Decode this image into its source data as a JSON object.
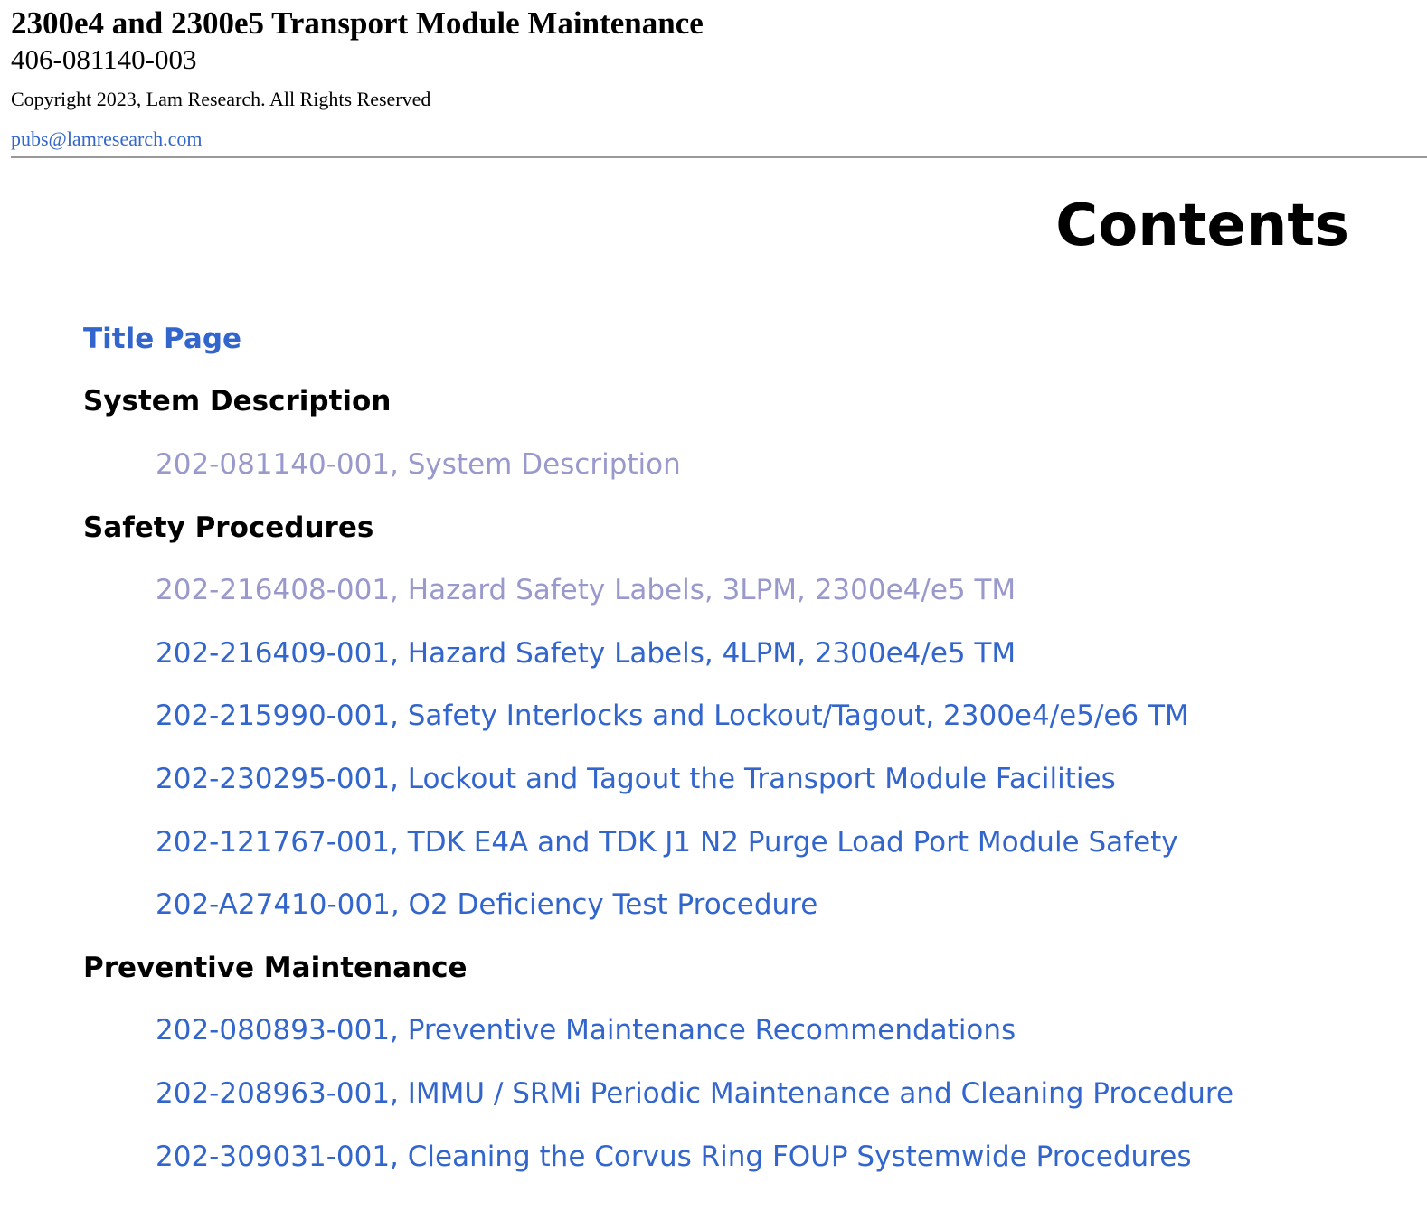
{
  "header": {
    "title": "2300e4 and 2300e5 Transport Module Maintenance",
    "document_number": "406-081140-003",
    "copyright": "Copyright 2023, Lam Research. All Rights Reserved",
    "email": "pubs@lamresearch.com"
  },
  "contents_heading": "Contents",
  "colors": {
    "link": "#3366cc",
    "visited_link": "#9999cc",
    "text": "#000000",
    "rule": "#999999"
  },
  "toc": {
    "title_page": {
      "label": "Title Page"
    },
    "sections": [
      {
        "label": "System Description",
        "entries": [
          {
            "label": "202-081140-001, System Description",
            "visited": true
          }
        ]
      },
      {
        "label": "Safety Procedures",
        "entries": [
          {
            "label": "202-216408-001, Hazard Safety Labels, 3LPM, 2300e4/e5 TM",
            "visited": true
          },
          {
            "label": "202-216409-001, Hazard Safety Labels, 4LPM, 2300e4/e5 TM",
            "visited": false
          },
          {
            "label": "202-215990-001, Safety Interlocks and Lockout/Tagout, 2300e4/e5/e6 TM",
            "visited": false
          },
          {
            "label": "202-230295-001, Lockout and Tagout the Transport Module Facilities",
            "visited": false
          },
          {
            "label": "202-121767-001, TDK E4A and TDK J1 N2 Purge Load Port Module Safety",
            "visited": false
          },
          {
            "label": "202-A27410-001, O2 Deficiency Test Procedure",
            "visited": false
          }
        ]
      },
      {
        "label": "Preventive Maintenance",
        "entries": [
          {
            "label": "202-080893-001, Preventive Maintenance Recommendations",
            "visited": false
          },
          {
            "label": "202-208963-001, IMMU / SRMi Periodic Maintenance and Cleaning Procedure",
            "visited": false
          },
          {
            "label": "202-309031-001, Cleaning the Corvus Ring FOUP Systemwide Procedures",
            "visited": false
          }
        ]
      }
    ]
  }
}
